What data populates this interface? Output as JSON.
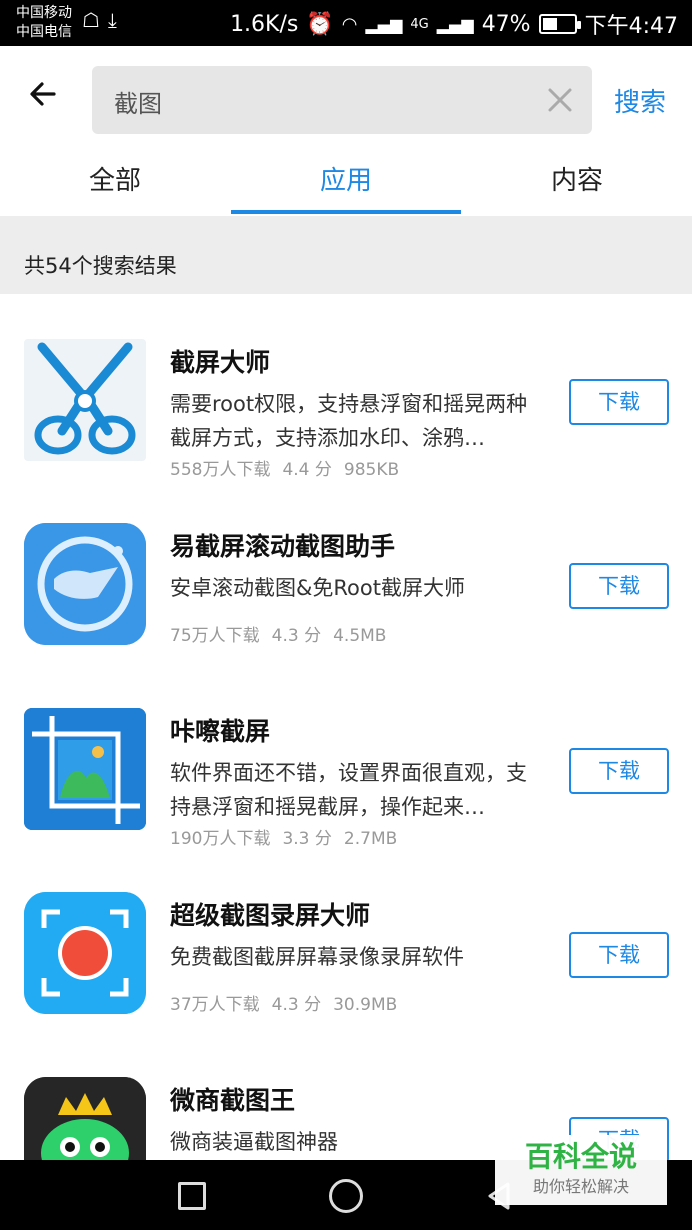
{
  "status_bar": {
    "carrier1": "中国移动",
    "carrier2": "中国电信",
    "speed": "1.6K/s",
    "network": "4G",
    "battery": "47%",
    "battery_level": 0.47,
    "time": "下午4:47"
  },
  "search": {
    "query": "截图",
    "button": "搜索",
    "back_icon": "back-arrow-icon",
    "clear_icon": "close-icon"
  },
  "tabs": [
    {
      "label": "全部",
      "active": false
    },
    {
      "label": "应用",
      "active": true
    },
    {
      "label": "内容",
      "active": false
    }
  ],
  "results": {
    "count_text": "共54个搜索结果"
  },
  "accent_color": "#1e88e5",
  "apps": [
    {
      "name": "截屏大师",
      "desc": "需要root权限，支持悬浮窗和摇晃两种截屏方式，支持添加水印、涂鸦…",
      "downloads": "558万人下载",
      "rating": "4.4 分",
      "size": "985KB",
      "button": "下载"
    },
    {
      "name": "易截屏滚动截图助手",
      "desc": "安卓滚动截图&免Root截屏大师",
      "downloads": "75万人下载",
      "rating": "4.3 分",
      "size": "4.5MB",
      "button": "下载"
    },
    {
      "name": "咔嚓截屏",
      "desc": "软件界面还不错，设置界面很直观，支持悬浮窗和摇晃截屏，操作起来…",
      "downloads": "190万人下载",
      "rating": "3.3 分",
      "size": "2.7MB",
      "button": "下载"
    },
    {
      "name": "超级截图录屏大师",
      "desc": "免费截图截屏屏幕录像录屏软件",
      "downloads": "37万人下载",
      "rating": "4.3 分",
      "size": "30.9MB",
      "button": "下载"
    },
    {
      "name": "微商截图王",
      "desc": "微商装逼截图神器",
      "downloads": "",
      "rating": "",
      "size": "",
      "button": "下载"
    }
  ],
  "watermark": {
    "title": "百科全说",
    "subtitle": "助你轻松解决"
  }
}
